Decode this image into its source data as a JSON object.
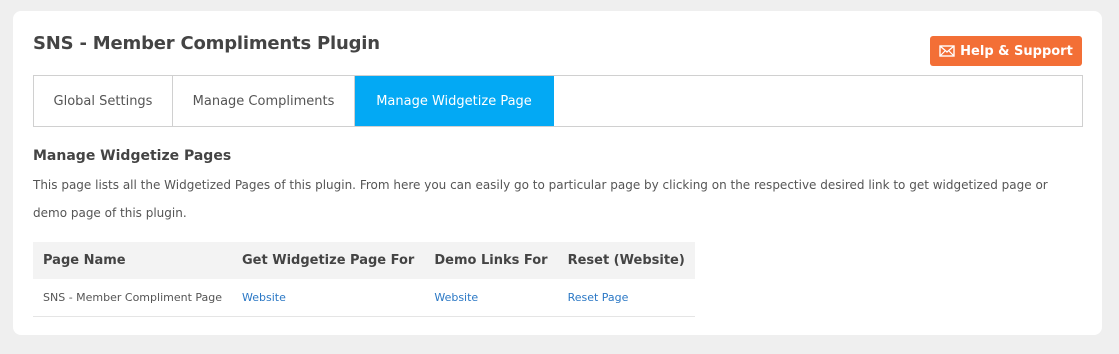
{
  "header": {
    "title": "SNS - Member Compliments Plugin",
    "help_button_label": "Help & Support",
    "help_icon": "envelope-icon",
    "accent_color": "#f36f36"
  },
  "tabs": [
    {
      "label": "Global Settings",
      "active": false
    },
    {
      "label": "Manage Compliments",
      "active": false
    },
    {
      "label": "Manage Widgetize Page",
      "active": true
    }
  ],
  "active_tab_color": "#03a9f4",
  "section": {
    "title": "Manage Widgetize Pages",
    "description": "This page lists all the Widgetized Pages of this plugin. From here you can easily go to particular page by clicking on the respective desired link to get widgetized page or demo page of this plugin."
  },
  "table": {
    "columns": [
      "Page Name",
      "Get Widgetize Page For",
      "Demo Links For",
      "Reset (Website)"
    ],
    "rows": [
      {
        "page_name": "SNS - Member Compliment Page",
        "widgetize_link": "Website",
        "demo_link": "Website",
        "reset_link": "Reset Page"
      }
    ]
  },
  "link_color": "#2b78c5"
}
